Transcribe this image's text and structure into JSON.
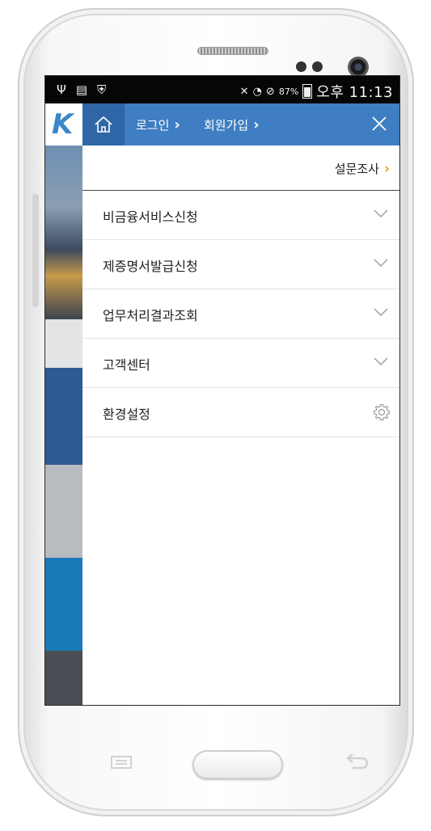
{
  "status_bar": {
    "battery_text": "87%",
    "time": "오후 11:13"
  },
  "header": {
    "login_label": "로그인",
    "signup_label": "회원가입"
  },
  "survey": {
    "label": "설문조사"
  },
  "menu": {
    "items": [
      {
        "label": "비금융서비스신청",
        "icon": "chevron-down-icon"
      },
      {
        "label": "제증명서발급신청",
        "icon": "chevron-down-icon"
      },
      {
        "label": "업무처리결과조회",
        "icon": "chevron-down-icon"
      },
      {
        "label": "고객센터",
        "icon": "chevron-down-icon"
      },
      {
        "label": "환경설정",
        "icon": "gear-icon"
      }
    ]
  },
  "colors": {
    "topbar": "#3f7ec2",
    "home_button": "#2f67a6",
    "accent_chevron": "#e8a21a",
    "logo": "#3a86c8"
  }
}
